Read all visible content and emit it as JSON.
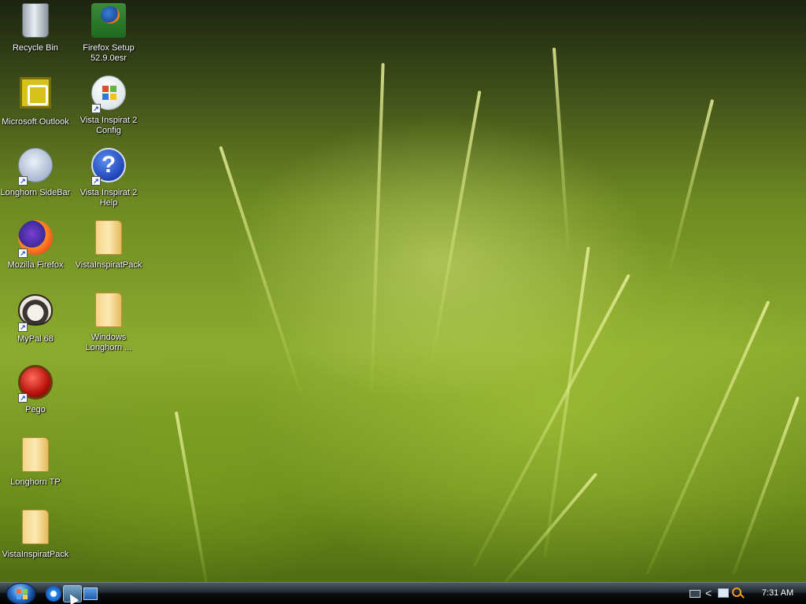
{
  "desktop_icons": [
    {
      "label": "Recycle Bin",
      "icon": "recycle-bin-icon"
    },
    {
      "label": "Firefox Setup 52.9.0esr",
      "icon": "firefox-setup-icon"
    },
    {
      "label": "Microsoft Outlook",
      "icon": "outlook-icon"
    },
    {
      "label": "Vista Inspirat 2 Config",
      "icon": "windows-logo-icon"
    },
    {
      "label": "Longhorn SideBar",
      "icon": "sidebar-icon"
    },
    {
      "label": "Vista Inspirat 2 Help",
      "icon": "help-icon"
    },
    {
      "label": "Mozilla Firefox",
      "icon": "firefox-icon"
    },
    {
      "label": "VistaInspiratPack",
      "icon": "zip-folder-icon"
    },
    {
      "label": "MyPal 68",
      "icon": "mypal-icon"
    },
    {
      "label": "Windows Longhorn ...",
      "icon": "zip-folder-icon"
    },
    {
      "label": "Pego",
      "icon": "pego-icon"
    },
    {
      "label": "Longhorn TP",
      "icon": "folder-icon"
    },
    {
      "label": "VistaInspiratPack",
      "icon": "folder-icon"
    }
  ],
  "help_glyph": "?",
  "shortcut_glyph": "↗",
  "taskbar": {
    "start_button": "start-orb-icon",
    "quick_launch": [
      "internet-explorer-icon",
      "active-app-icon",
      "show-desktop-icon"
    ],
    "tray": {
      "chevron": "<",
      "clock": "7:31 AM"
    }
  }
}
